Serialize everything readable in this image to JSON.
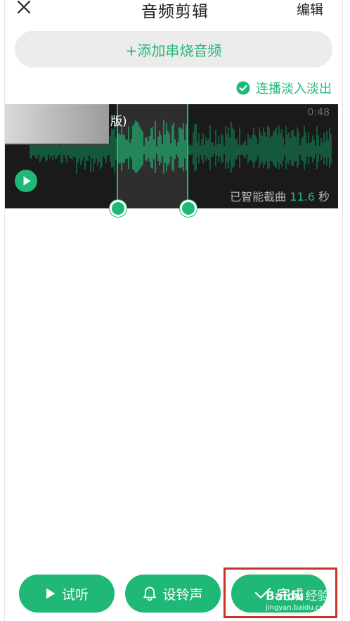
{
  "header": {
    "title": "音频剪辑",
    "edit_label": "编辑"
  },
  "add_medley": {
    "label": "+添加串烧音频"
  },
  "fade": {
    "label": "连播淡入淡出",
    "checked": true
  },
  "track": {
    "title_visible": "版)",
    "duration": "0:48",
    "smart_cut_prefix": "已智能截曲",
    "smart_cut_value": "11.6",
    "smart_cut_unit": "秒"
  },
  "actions": {
    "preview_label": "试听",
    "ringtone_label": "设铃声",
    "done_label": "完成"
  },
  "watermark": {
    "logo": "Baidu",
    "jingyan": "经验",
    "url": "jingyan.baidu.com"
  },
  "colors": {
    "accent": "#1fb876",
    "wave_bg": "#1a1a1a",
    "highlight_box": "#c8332b"
  },
  "icons": {
    "close": "close-icon",
    "check": "check-circle-icon",
    "play": "play-icon",
    "bell": "bell-icon",
    "done": "check-icon"
  }
}
